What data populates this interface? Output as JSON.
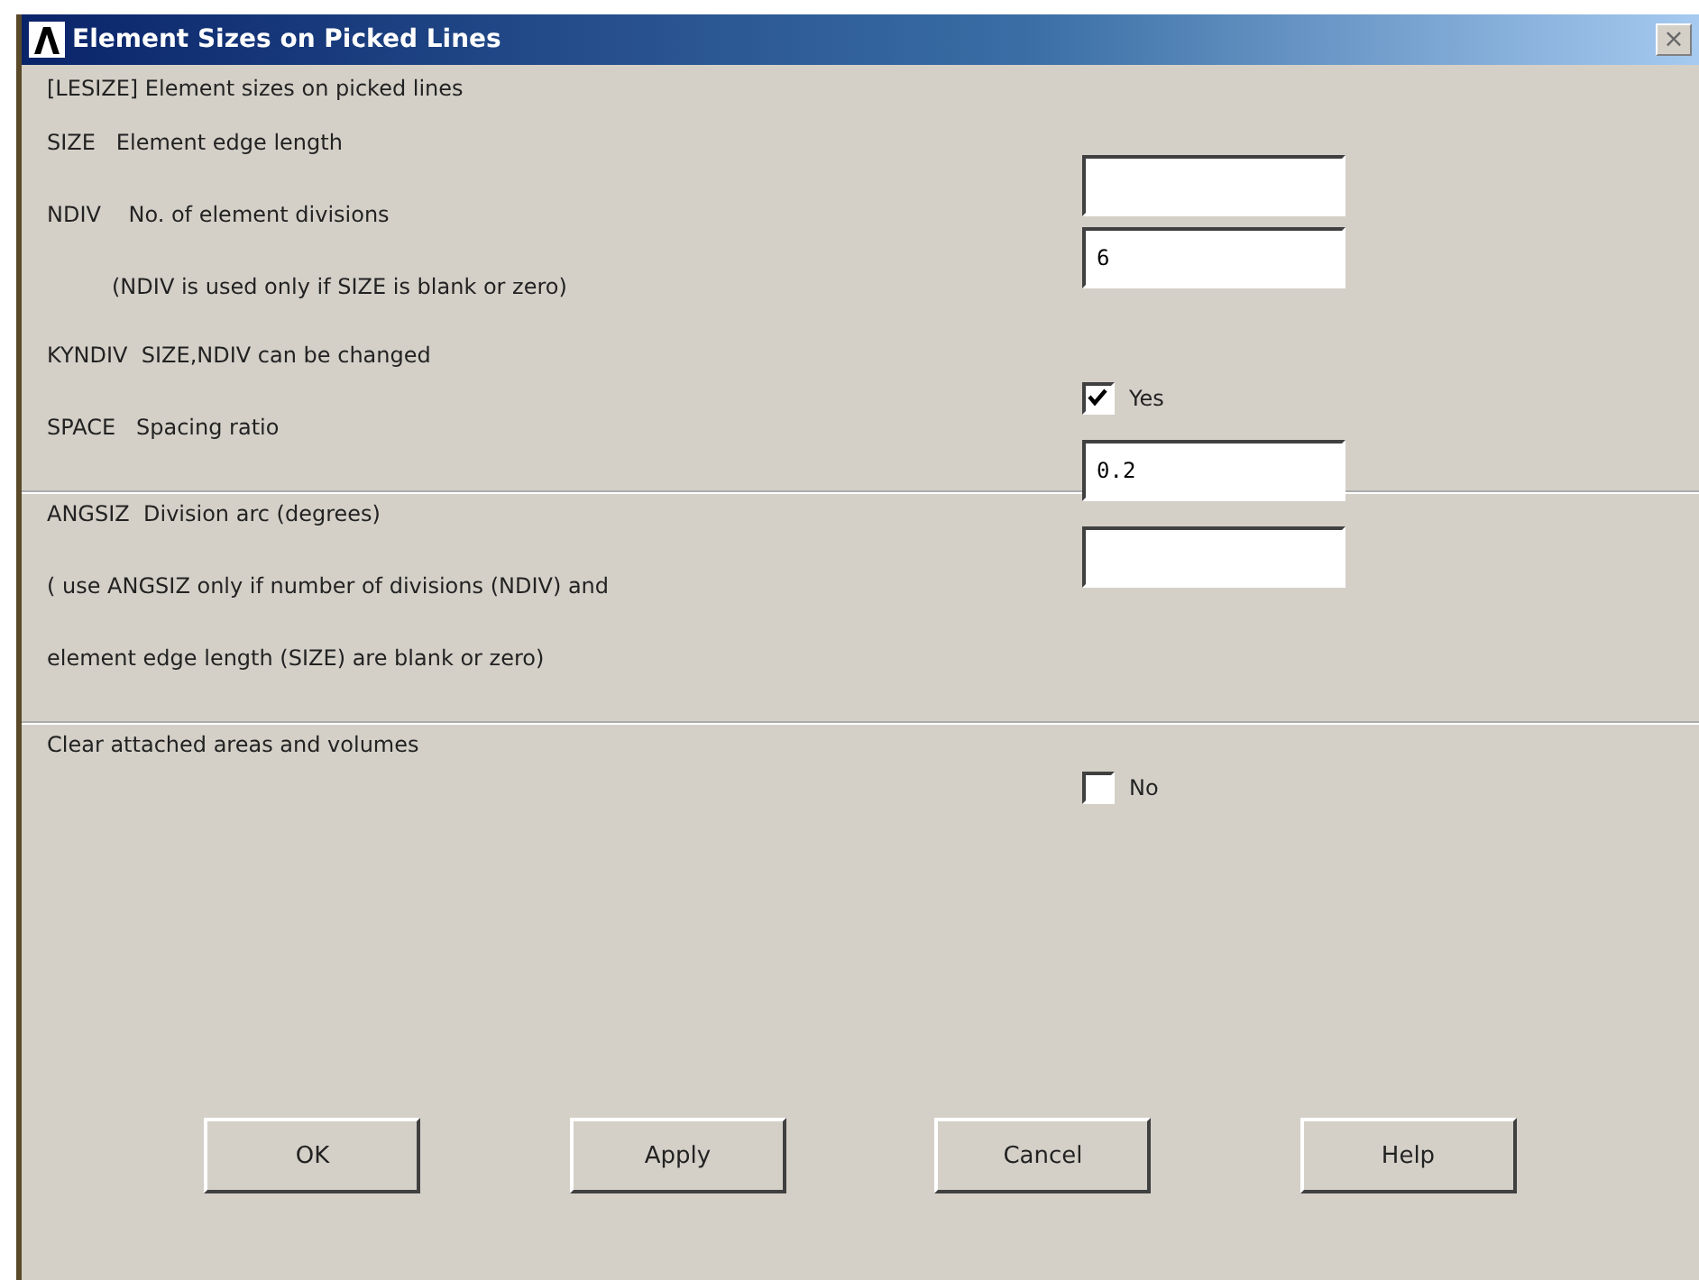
{
  "window": {
    "title": "Element Sizes on Picked Lines",
    "close": "×"
  },
  "header": "[LESIZE]  Element sizes on picked lines",
  "sections": [
    {
      "rows": [
        {
          "kind": "field",
          "label": "SIZE   Element edge length",
          "value": ""
        },
        {
          "kind": "field",
          "label": "NDIV    No. of element divisions",
          "value": "6"
        },
        {
          "kind": "note",
          "label": "(NDIV is used only if SIZE is blank or zero)"
        },
        {
          "kind": "checkbox",
          "label": "KYNDIV  SIZE,NDIV can be changed",
          "checked": true,
          "text": "Yes"
        },
        {
          "kind": "field",
          "label": "SPACE   Spacing ratio",
          "value": "0.2"
        }
      ]
    },
    {
      "rows": [
        {
          "kind": "field",
          "label": "ANGSIZ  Division arc (degrees)",
          "value": ""
        },
        {
          "kind": "text",
          "label": "( use ANGSIZ only if number of divisions (NDIV) and"
        },
        {
          "kind": "text",
          "label": "element edge length (SIZE) are blank or zero)"
        }
      ]
    },
    {
      "rows": [
        {
          "kind": "checkbox",
          "label": "Clear attached areas and volumes",
          "checked": false,
          "text": "No"
        }
      ]
    }
  ],
  "buttons": [
    "OK",
    "Apply",
    "Cancel",
    "Help"
  ]
}
